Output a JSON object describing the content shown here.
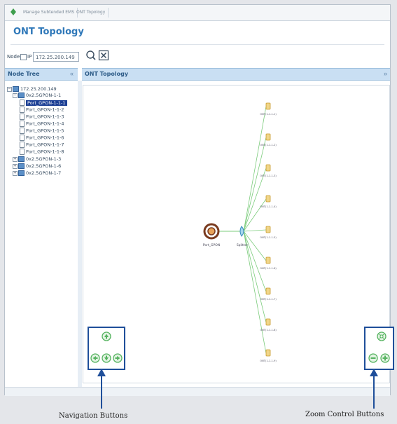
{
  "tabs": [
    "Manage Subtended EMS",
    "ONT Topology"
  ],
  "page_title": "ONT Topology",
  "node_filter": {
    "node_label": "Node:",
    "ip_label": "IP",
    "ip_value": "172.25.200.149"
  },
  "panels": {
    "left_header": "Node Tree",
    "left_collapse": "«",
    "right_header": "ONT Topology",
    "right_collapse": "»"
  },
  "tree": {
    "root": "172.25.200.149",
    "expanded_card": "0x2.5GPON-1-1",
    "ports": [
      "Port_GPON-1-1-1",
      "Port_GPON-1-1-2",
      "Port_GPON-1-1-3",
      "Port_GPON-1-1-4",
      "Port_GPON-1-1-5",
      "Port_GPON-1-1-6",
      "Port_GPON-1-1-7",
      "Port_GPON-1-1-8"
    ],
    "selected_port": "Port_GPON-1-1-1",
    "collapsed_cards": [
      "0x2.5GPON-1-3",
      "0x2.5GPON-1-6",
      "0x2.5GPON-1-7"
    ]
  },
  "topology": {
    "olt_label": "Port_GPON",
    "splitter_label": "Splitter",
    "onts": [
      "ONT(1-1-1-1)",
      "ONT(1-1-1-2)",
      "ONT(1-1-1-3)",
      "ONT(1-1-1-4)",
      "ONT(1-1-1-5)",
      "ONT(1-1-1-6)",
      "ONT(1-1-1-7)",
      "ONT(1-1-1-8)",
      "ONT(1-1-1-9)"
    ]
  },
  "annotations": {
    "navigation": "Navigation Buttons",
    "zoom": "Zoom Control Buttons"
  },
  "colors": {
    "accent": "#2f78b9",
    "header_bg": "#c9dff3",
    "highlight_box": "#1f4f9a",
    "link_line": "#7ccc7c",
    "ont": "#c89a2c",
    "control_green": "#55b35f"
  }
}
